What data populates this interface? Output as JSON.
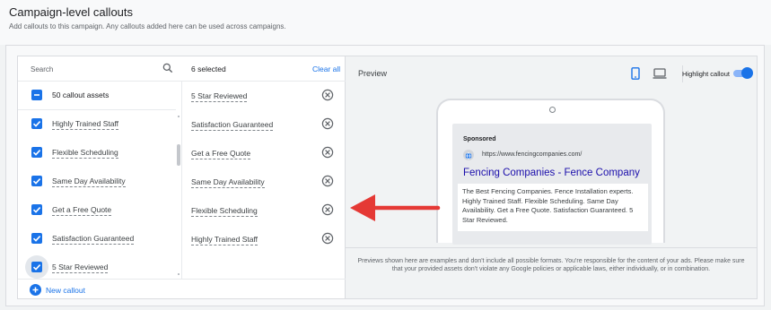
{
  "page": {
    "title": "Campaign-level callouts",
    "subtitle": "Add callouts to this campaign. Any callouts added here can be used across campaigns."
  },
  "picker": {
    "search_label": "Search",
    "select_all_label": "50 callout assets",
    "items": [
      {
        "label": "Highly Trained Staff",
        "checked": true
      },
      {
        "label": "Flexible Scheduling",
        "checked": true
      },
      {
        "label": "Same Day Availability",
        "checked": true
      },
      {
        "label": "Get a Free Quote",
        "checked": true
      },
      {
        "label": "Satisfaction Guaranteed",
        "checked": true
      },
      {
        "label": "5 Star Reviewed",
        "checked": true
      }
    ],
    "new_callout_label": "New callout"
  },
  "selected": {
    "count_label": "6 selected",
    "clear_all_label": "Clear all",
    "items": [
      {
        "label": "5 Star Reviewed"
      },
      {
        "label": "Satisfaction Guaranteed"
      },
      {
        "label": "Get a Free Quote"
      },
      {
        "label": "Same Day Availability"
      },
      {
        "label": "Flexible Scheduling"
      },
      {
        "label": "Highly Trained Staff"
      }
    ]
  },
  "preview": {
    "title": "Preview",
    "highlight_label": "Highlight callout",
    "highlight_on": true,
    "ad": {
      "sponsored": "Sponsored",
      "url": "https://www.fencingcompanies.com/",
      "headline": "Fencing Companies - Fence Company",
      "description": "The Best Fencing Companies. Fence Installation experts. Highly Trained Staff. Flexible Scheduling. Same Day Availability. Get a Free Quote. Satisfaction Guaranteed. 5 Star Reviewed."
    },
    "disclaimer": "Previews shown here are examples and don't include all possible formats. You're responsible for the content of your ads. Please make sure that your provided assets don't violate any Google policies or applicable laws, either individually, or in combination."
  },
  "colors": {
    "accent": "#1a73e8",
    "headline_link": "#1a0dab",
    "annotation_arrow": "#e53935"
  }
}
